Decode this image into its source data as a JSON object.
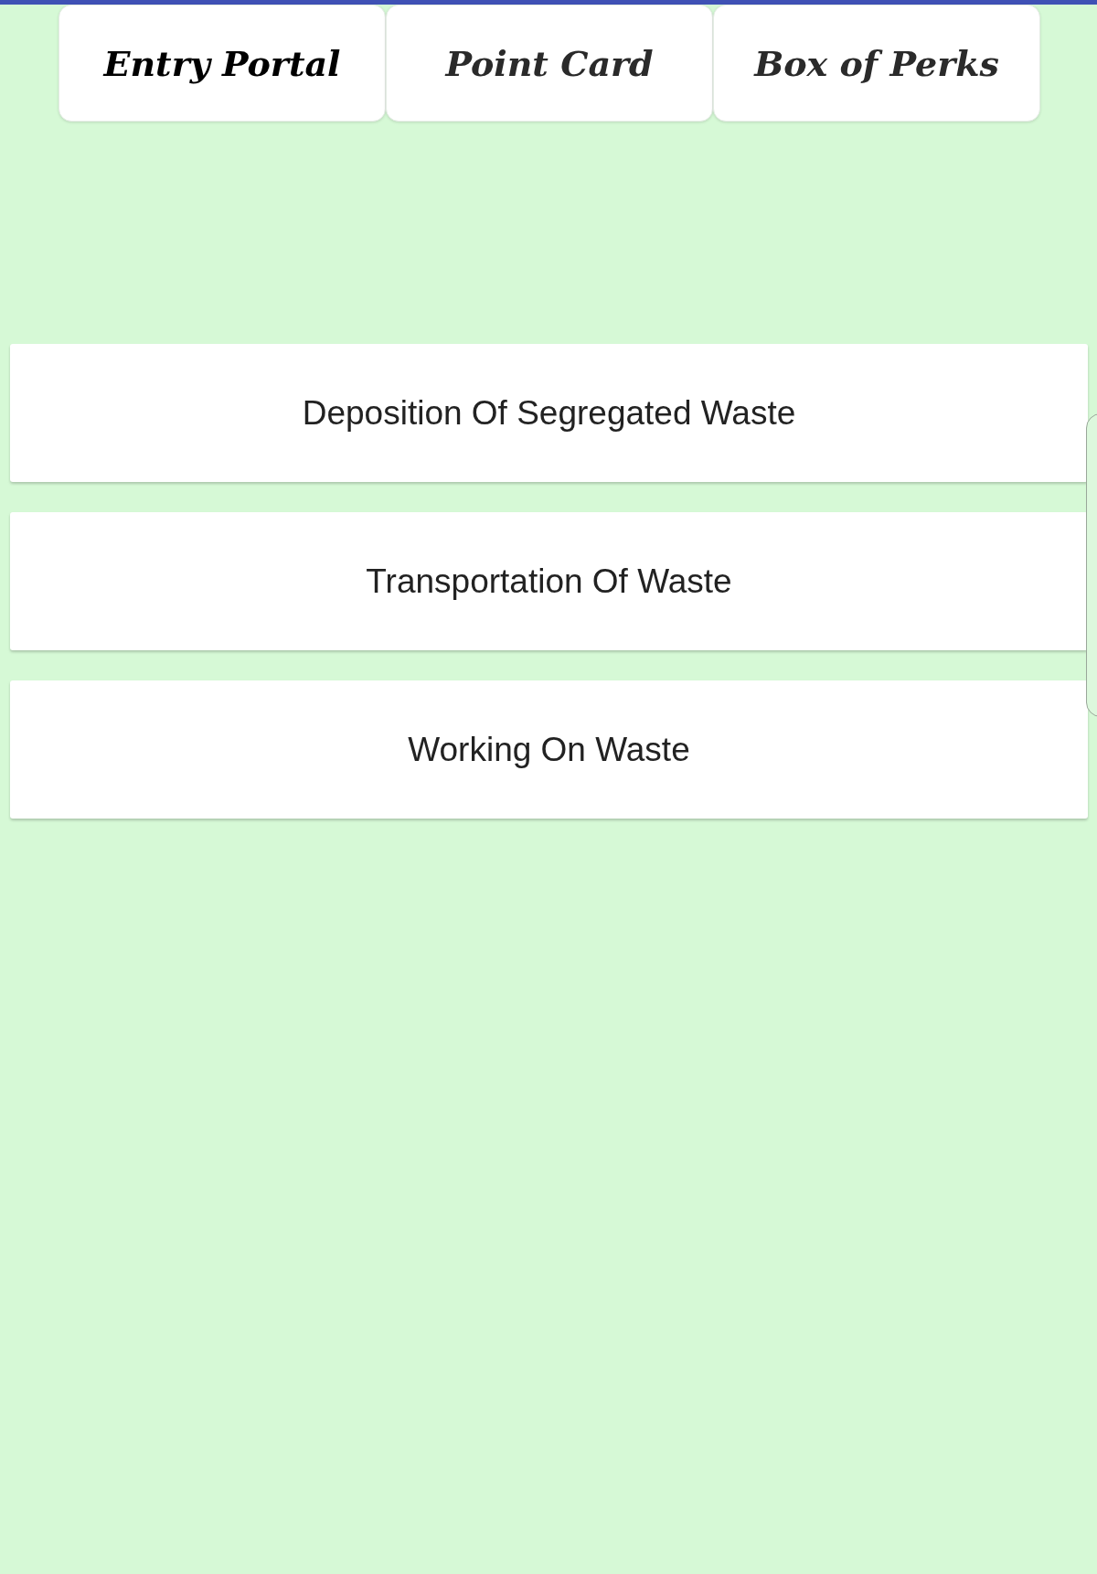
{
  "tabs": [
    {
      "label": "Entry Portal",
      "selected": true
    },
    {
      "label": "Point Card",
      "selected": false
    },
    {
      "label": "Box of Perks",
      "selected": false
    }
  ],
  "options": [
    {
      "label": "Deposition Of Segregated Waste"
    },
    {
      "label": "Transportation Of Waste"
    },
    {
      "label": "Working On Waste"
    }
  ]
}
